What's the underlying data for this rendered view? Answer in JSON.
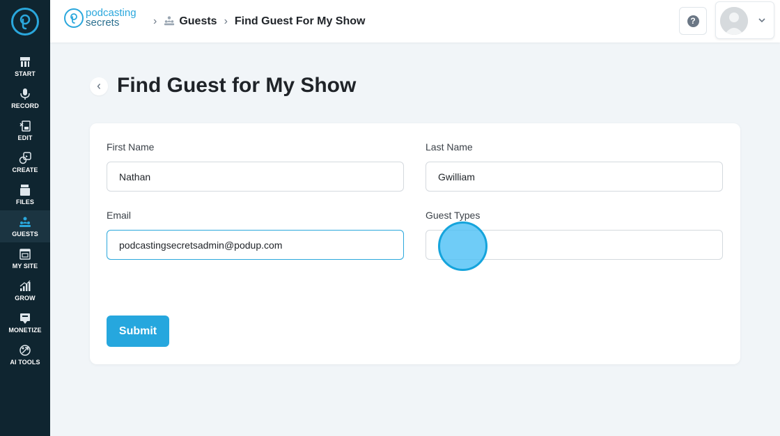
{
  "sidebar": {
    "items": [
      {
        "label": "START",
        "icon": "start-icon"
      },
      {
        "label": "RECORD",
        "icon": "microphone-icon"
      },
      {
        "label": "EDIT",
        "icon": "edit-icon"
      },
      {
        "label": "CREATE",
        "icon": "create-icon"
      },
      {
        "label": "FILES",
        "icon": "files-icon"
      },
      {
        "label": "GUESTS",
        "icon": "guests-icon",
        "active": true
      },
      {
        "label": "MY SITE",
        "icon": "site-icon"
      },
      {
        "label": "GROW",
        "icon": "grow-icon"
      },
      {
        "label": "MONETIZE",
        "icon": "monetize-icon"
      },
      {
        "label": "AI TOOLS",
        "icon": "ai-tools-icon"
      }
    ]
  },
  "header": {
    "brand_line1": "podcasting",
    "brand_line2": "secrets",
    "breadcrumb": [
      "Guests",
      "Find Guest For My Show"
    ],
    "help_label": "?"
  },
  "page": {
    "title": "Find Guest for My Show"
  },
  "form": {
    "first_name_label": "First Name",
    "first_name_value": "Nathan",
    "last_name_label": "Last Name",
    "last_name_value": "Gwilliam",
    "email_label": "Email",
    "email_value": "podcastingsecretsadmin@podup.com",
    "guest_types_label": "Guest Types",
    "guest_types_value": "",
    "submit_label": "Submit"
  },
  "colors": {
    "sidebar_bg": "#0f2530",
    "accent": "#26a7de",
    "page_bg": "#f1f5f8"
  }
}
